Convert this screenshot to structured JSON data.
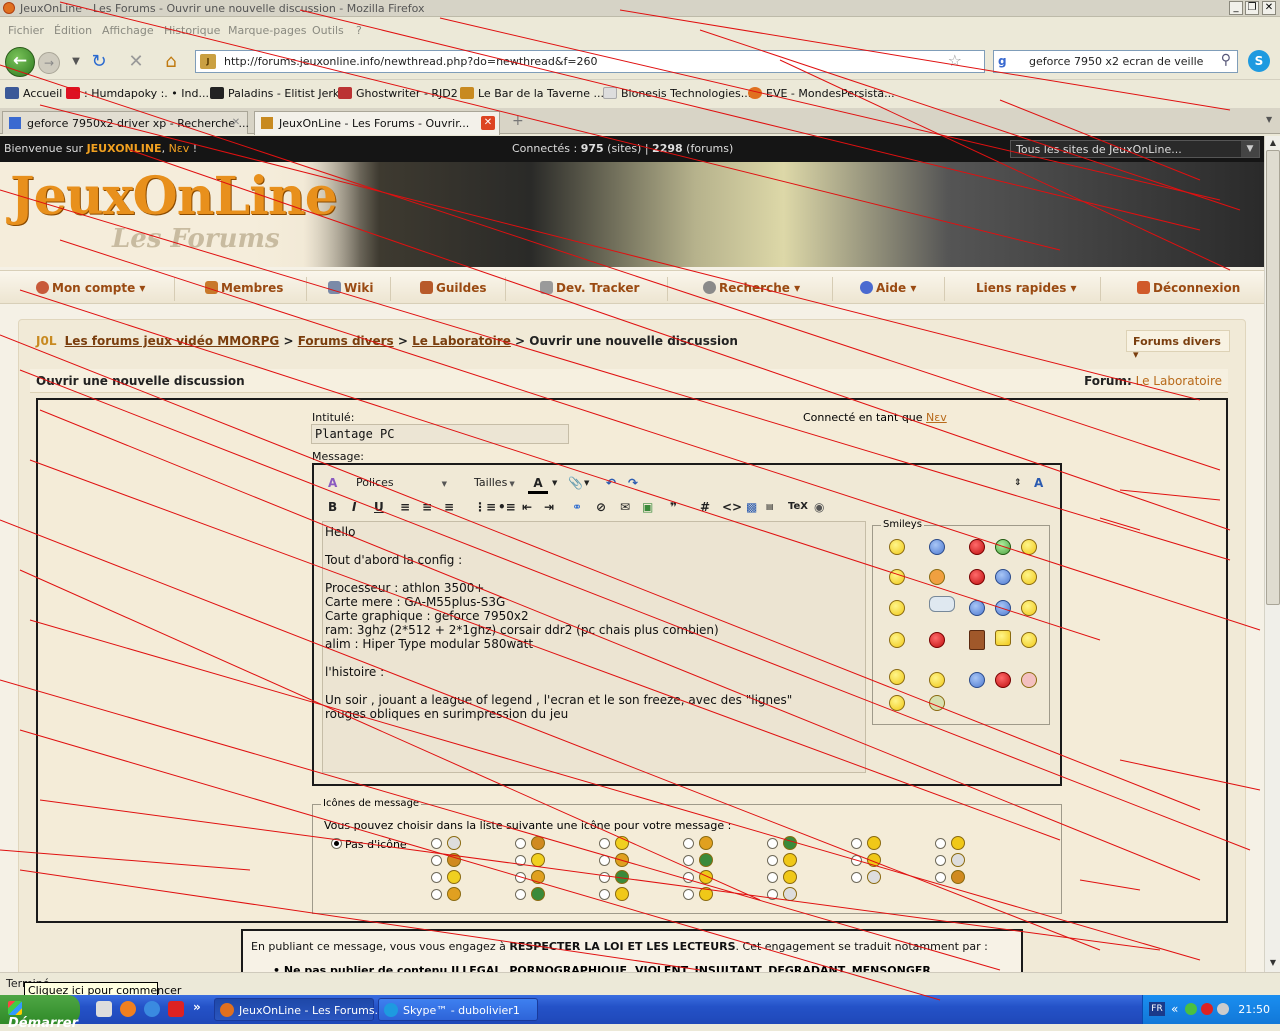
{
  "window": {
    "title": "JeuxOnLine - Les Forums - Ouvrir une nouvelle discussion - Mozilla Firefox",
    "buttons": [
      "_",
      "❐",
      "✕"
    ]
  },
  "menubar": [
    "Fichier",
    "Édition",
    "Affichage",
    "Historique",
    "Marque-pages",
    "Outils",
    "?"
  ],
  "navbar": {
    "url": "http://forums.jeuxonline.info/newthread.php?do=newthread&f=260",
    "search": "geforce 7950 x2 ecran de veille"
  },
  "bookmarks": [
    "Accueil",
    ": Humdapoky :. • Ind...",
    "Paladins - Elitist Jerks",
    "Ghostwriter - RJD2",
    "Le Bar de la Taverne ...",
    "Bionesis Technologies...",
    "EVE - MondesPersista..."
  ],
  "tabs": [
    {
      "label": "geforce 7950x2 driver xp - Recherche ..."
    },
    {
      "label": "JeuxOnLine - Les Forums - Ouvrir..."
    }
  ],
  "jolbar": {
    "welcome_prefix": "Bienvenue sur",
    "logo": "JEUXONLINE",
    "user": "Nεv",
    "welcome_suffix": "!",
    "connected_label": "Connectés :",
    "connected_sites": "975",
    "sites_label": "(sites) |",
    "connected_forums": "2298",
    "forums_label": "(forums)",
    "sites_select": "Tous les sites de JeuxOnLine..."
  },
  "banner": {
    "line1": "JeuxOnLine",
    "line2": "Les Forums"
  },
  "mainmenu": [
    "Mon compte",
    "Membres",
    "Wiki",
    "Guildes",
    "Dev. Tracker",
    "Recherche",
    "Aide",
    "Liens rapides",
    "Déconnexion"
  ],
  "breadcrumb": {
    "logo": "J0L",
    "c1": "Les forums jeux vidéo MMORPG",
    "sep": ">",
    "c2": "Forums divers",
    "c3": "Le Laboratoire",
    "current": "Ouvrir une nouvelle discussion",
    "dropdown": "Forums divers"
  },
  "form": {
    "heading": "Ouvrir une nouvelle discussion",
    "forum_label": "Forum:",
    "forum_name": "Le Laboratoire",
    "title_label": "Intitulé:",
    "title_value": "Plantage PC",
    "connected_as": "Connecté en tant que",
    "connected_user": "Nεv",
    "message_label": "Message:",
    "font_select": "Polices",
    "size_select": "Tailles",
    "message_text": "Hello\n\nTout d'abord la config :\n\nProcesseur : athlon 3500+\nCarte mere : GA-M55plus-S3G\nCarte graphique : geforce 7950x2\nram: 3ghz (2*512 + 2*1ghz) corsair ddr2 (pc chais plus combien)\nalim : Hiper Type modular 580watt\n\nl'histoire :\n\nUn soir , jouant a league of legend , l'ecran et le son freeze, avec des \"lignes\"\nrouges obliques en surimpression du jeu",
    "smileys_legend": "Smileys",
    "icons_legend": "Icônes de message",
    "icons_intro": "Vous pouvez choisir dans la liste suivante une icône pour votre message :",
    "no_icon": "Pas d'icône"
  },
  "notice": {
    "prefix": "En publiant ce message, vous vous engagez à",
    "strong": "RESPECTER LA LOI ET LES LECTEURS",
    "suffix": ". Cet engagement se traduit notamment par :",
    "item": "Ne pas publier de contenu ILLEGAL, PORNOGRAPHIQUE, VIOLENT, INSULTANT, DEGRADANT, MENSONGER"
  },
  "status": {
    "text": "Terminé",
    "tooltip": "Cliquez ici pour commencer"
  },
  "taskbar": {
    "start": "Démarrer",
    "buttons": [
      "JeuxOnLine - Les Forums...",
      "Skype™ - dubolivier1"
    ],
    "lang": "FR",
    "clock": "21:50"
  }
}
